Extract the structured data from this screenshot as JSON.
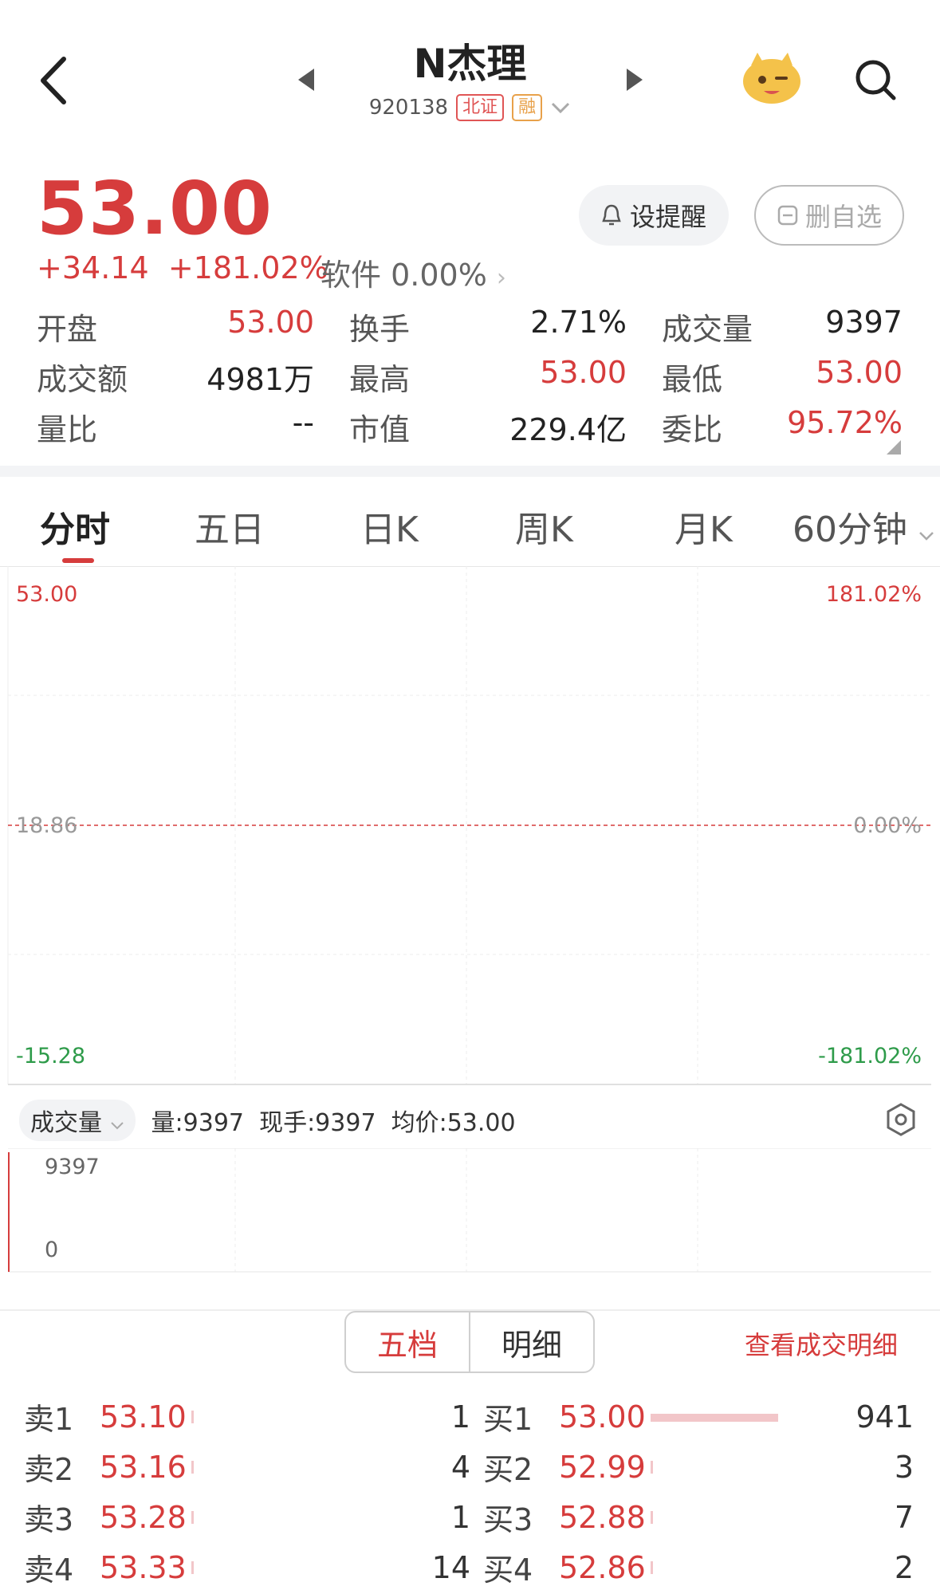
{
  "header": {
    "title": "N杰理",
    "code": "920138",
    "tag_exchange": "北证",
    "tag_margin": "融"
  },
  "quote": {
    "price": "53.00",
    "change": "+34.14",
    "change_pct": "+181.02%",
    "sector": "软件 0.00%",
    "alert_button": "设提醒",
    "remove_button": "删自选"
  },
  "stats": [
    [
      {
        "label": "开盘",
        "value": "53.00",
        "color": "red"
      },
      {
        "label": "换手",
        "value": "2.71%",
        "color": "dark"
      },
      {
        "label": "成交量",
        "value": "9397",
        "color": "dark"
      }
    ],
    [
      {
        "label": "成交额",
        "value": "4981万",
        "color": "dark"
      },
      {
        "label": "最高",
        "value": "53.00",
        "color": "red"
      },
      {
        "label": "最低",
        "value": "53.00",
        "color": "red"
      }
    ],
    [
      {
        "label": "量比",
        "value": "--",
        "color": "dark"
      },
      {
        "label": "市值",
        "value": "229.4亿",
        "color": "dark"
      },
      {
        "label": "委比",
        "value": "95.72%",
        "color": "red"
      }
    ]
  ],
  "tabs": [
    "分时",
    "五日",
    "日K",
    "周K",
    "月K",
    "60分钟"
  ],
  "chart_data": {
    "type": "line",
    "y_left_labels": {
      "top": "53.00",
      "mid": "18.86",
      "bottom": "-15.28"
    },
    "y_right_labels": {
      "top": "181.02%",
      "mid": "0.00%",
      "bottom": "-181.02%"
    },
    "ylim": [
      -15.28,
      53.0
    ],
    "reference_price": 18.86,
    "x": [],
    "series": []
  },
  "volume": {
    "selector": "成交量",
    "summary": "量:9397  现手:9397  均价:53.00",
    "max_label": "9397",
    "min_label": "0",
    "values": [
      9397
    ]
  },
  "order_book": {
    "tab_1": "五档",
    "tab_2": "明细",
    "link": "查看成交明细",
    "sell": [
      {
        "level": "卖1",
        "price": "53.10",
        "qty": "1"
      },
      {
        "level": "卖2",
        "price": "53.16",
        "qty": "4"
      },
      {
        "level": "卖3",
        "price": "53.28",
        "qty": "1"
      },
      {
        "level": "卖4",
        "price": "53.33",
        "qty": "14"
      }
    ],
    "buy": [
      {
        "level": "买1",
        "price": "53.00",
        "qty": "941"
      },
      {
        "level": "买2",
        "price": "52.99",
        "qty": "3"
      },
      {
        "level": "买3",
        "price": "52.88",
        "qty": "7"
      },
      {
        "level": "买4",
        "price": "52.86",
        "qty": "2"
      }
    ]
  },
  "colors": {
    "up": "#d63c3c",
    "down": "#2e9b4a",
    "accent": "#d63c3c"
  },
  "icons": [
    "back-icon",
    "prev-icon",
    "next-icon",
    "chevron-down-icon",
    "mascot-icon",
    "search-icon",
    "bell-icon",
    "minus-box-icon",
    "settings-icon"
  ]
}
